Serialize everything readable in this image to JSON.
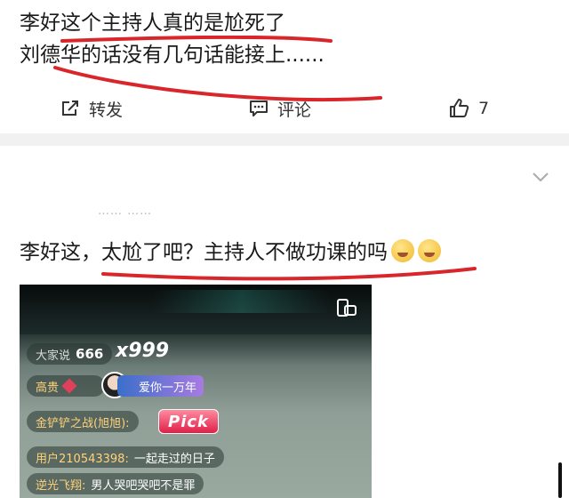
{
  "post1": {
    "line1": "李好这个主持人真的是尬死了",
    "line2": "刘德华的话没有几句话能接上......",
    "actions": {
      "repost_label": "转发",
      "comment_label": "评论",
      "like_count": "7"
    }
  },
  "post2": {
    "faded_text": "…… ……",
    "comment_text": "李好这，太尬了吧？主持人不做功课的吗",
    "video": {
      "chat": [
        {
          "user": "大家说",
          "count": "666",
          "multiplier": "x999"
        },
        {
          "user": "高贵",
          "gift": "爱你一万年"
        },
        {
          "user": "金铲铲之战(旭旭):",
          "gift": "Pick"
        },
        {
          "user": "用户210543398:",
          "message": "一起走过的日子"
        },
        {
          "user": "逆光飞翔:",
          "message": "男人哭吧哭吧不是罪"
        }
      ]
    }
  },
  "colors": {
    "annotation_red": "#d8262a",
    "divider": "#f1f1f1"
  }
}
